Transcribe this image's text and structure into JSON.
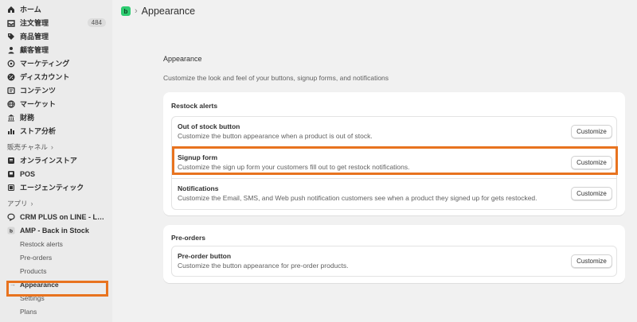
{
  "sidebar": {
    "main_items": [
      {
        "label": "ホーム",
        "icon": "home-icon"
      },
      {
        "label": "注文管理",
        "icon": "inbox-icon",
        "badge": "484"
      },
      {
        "label": "商品管理",
        "icon": "tag-icon"
      },
      {
        "label": "顧客管理",
        "icon": "person-icon"
      },
      {
        "label": "マーケティング",
        "icon": "target-icon"
      },
      {
        "label": "ディスカウント",
        "icon": "discount-icon"
      },
      {
        "label": "コンテンツ",
        "icon": "content-icon"
      },
      {
        "label": "マーケット",
        "icon": "globe-icon"
      },
      {
        "label": "財務",
        "icon": "bank-icon"
      },
      {
        "label": "ストア分析",
        "icon": "bar-chart-icon"
      }
    ],
    "sales_channels": {
      "title": "販売チャネル",
      "items": [
        {
          "label": "オンラインストア",
          "icon": "store-icon"
        },
        {
          "label": "POS",
          "icon": "pos-icon"
        },
        {
          "label": "エージェンティック",
          "icon": "agentic-icon"
        }
      ]
    },
    "apps": {
      "title": "アプリ",
      "items": [
        {
          "label": "CRM PLUS on LINE - LINE...",
          "icon": "chat-icon"
        },
        {
          "label": "AMP - Back in Stock",
          "icon": "app-icon"
        }
      ],
      "sub_items": [
        "Restock alerts",
        "Pre-orders",
        "Products",
        "Appearance",
        "Settings",
        "Plans"
      ],
      "active_sub": "Appearance"
    }
  },
  "header": {
    "app_logo_letter": "b",
    "separator": "›",
    "title": "Appearance"
  },
  "main": {
    "title": "Appearance",
    "description": "Customize the look and feel of your buttons, signup forms, and notifications",
    "cards": [
      {
        "title": "Restock alerts",
        "rows": [
          {
            "title": "Out of stock button",
            "description": "Customize the button appearance when a product is out of stock.",
            "button": "Customize"
          },
          {
            "title": "Signup form",
            "description": "Customize the sign up form your customers fill out to get restock notifications.",
            "button": "Customize"
          },
          {
            "title": "Notifications",
            "description": "Customize the Email, SMS, and Web push notification customers see when a product they signed up for gets restocked.",
            "button": "Customize"
          }
        ]
      },
      {
        "title": "Pre-orders",
        "rows": [
          {
            "title": "Pre-order button",
            "description": "Customize the button appearance for pre-order products.",
            "button": "Customize"
          }
        ]
      }
    ]
  },
  "colors": {
    "highlight": "#e8731f",
    "app_logo": "#2ecc71",
    "sidebar_bg": "#ebebeb",
    "page_bg": "#f1f1f1"
  }
}
